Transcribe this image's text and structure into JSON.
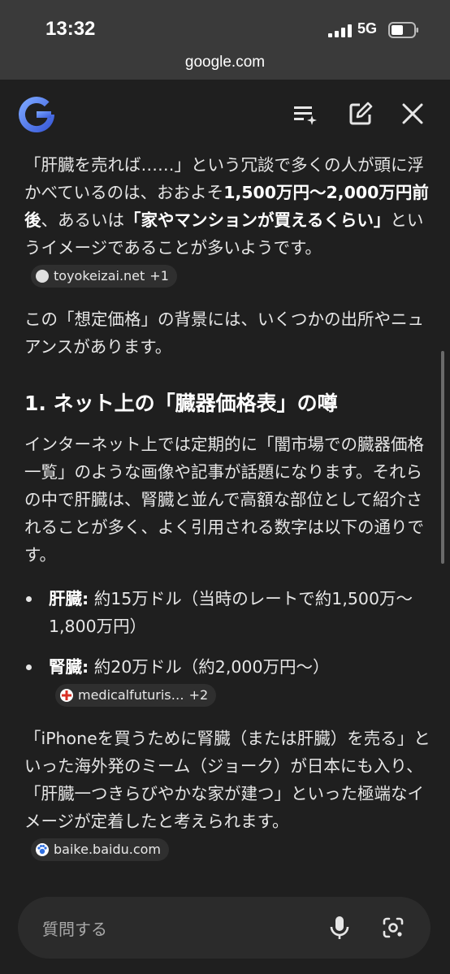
{
  "status_bar": {
    "time": "13:32",
    "network": "5G"
  },
  "browser": {
    "url": "google.com"
  },
  "toolbar": {
    "logo_icon": "google-g-logo",
    "icons": [
      "playlist-sparkle-icon",
      "edit-note-icon",
      "close-icon"
    ]
  },
  "content": {
    "p1_a": "「肝臓を売れば……」という冗談で多くの人が頭に浮かべているのは、おおよそ",
    "p1_b1": "1,500万円〜2,000万円前後",
    "p1_c": "、あるいは",
    "p1_b2": "「家やマンションが買えるくらい」",
    "p1_d": "というイメージであることが多いようです。",
    "chip1": {
      "label": "toyokeizai.net",
      "plus": "+1"
    },
    "p2": "この「想定価格」の背景には、いくつかの出所やニュアンスがあります。",
    "h1": "1. ネット上の「臓器価格表」の噂",
    "p3": "インターネット上では定期的に「闇市場での臓器価格一覧」のような画像や記事が話題になります。それらの中で肝臓は、腎臓と並んで高額な部位として紹介されることが多く、よく引用される数字は以下の通りです。",
    "bullets": [
      {
        "term": "肝臓:",
        "text": " 約15万ドル（当時のレートで約1,500万〜1,800万円）"
      },
      {
        "term": "腎臓:",
        "text": " 約20万ドル（約2,000万円〜）"
      }
    ],
    "chip2": {
      "label": "medicalfuturis…",
      "plus": "+2"
    },
    "p4": "「iPhoneを買うために腎臓（または肝臓）を売る」といった海外発のミーム（ジョーク）が日本にも入り、「肝臓一つきらびやかな家が建つ」といった極端なイメージが定着したと考えられます。",
    "chip3": {
      "label": "baike.baidu.com"
    }
  },
  "ask_bar": {
    "placeholder": "質問する",
    "icons": [
      "mic-icon",
      "lens-icon"
    ]
  },
  "colors": {
    "background": "#1f1f1f",
    "browser_bar": "#3a3a3a",
    "chip": "#2f2f2f"
  }
}
